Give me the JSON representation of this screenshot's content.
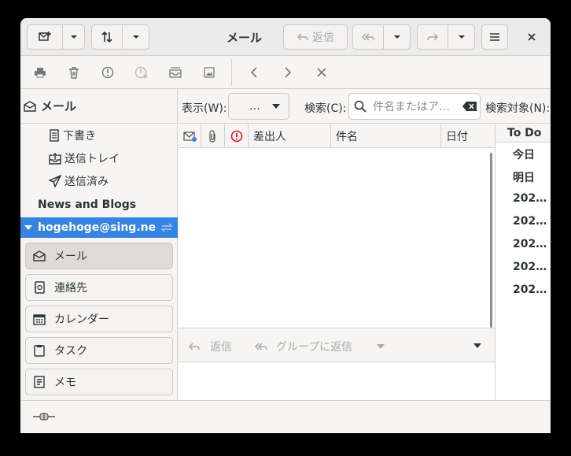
{
  "header": {
    "title": "メール",
    "reply_label": "返信"
  },
  "sidebar": {
    "heading": "メール",
    "folders": [
      {
        "label": "下書き",
        "icon": "drafts-icon"
      },
      {
        "label": "送信トレイ",
        "icon": "outbox-icon"
      },
      {
        "label": "送信済み",
        "icon": "sent-icon"
      }
    ],
    "accounts": [
      {
        "label": "News and Blogs"
      },
      {
        "label": "hogehoge@sing.ne…"
      }
    ],
    "nav": [
      {
        "label": "メール",
        "icon": "mail-icon"
      },
      {
        "label": "連絡先",
        "icon": "contacts-icon"
      },
      {
        "label": "カレンダー",
        "icon": "calendar-icon"
      },
      {
        "label": "タスク",
        "icon": "tasks-icon"
      },
      {
        "label": "メモ",
        "icon": "memo-icon"
      }
    ]
  },
  "filter": {
    "view_label": "表示(W):",
    "view_value": "…",
    "search_label": "検索(C):",
    "search_placeholder": "件名またはア…",
    "scope_label": "検索対象(N):"
  },
  "columns": {
    "sender": "差出人",
    "subject": "件名",
    "date": "日付"
  },
  "message_bar": {
    "reply": "返信",
    "reply_group": "グループに返信"
  },
  "todo": {
    "heading": "To Do",
    "items": [
      "今日",
      "明日",
      "202…",
      "202…",
      "202…",
      "202…",
      "202…"
    ]
  },
  "colors": {
    "accent": "#3584e4",
    "important": "#e01b24"
  }
}
